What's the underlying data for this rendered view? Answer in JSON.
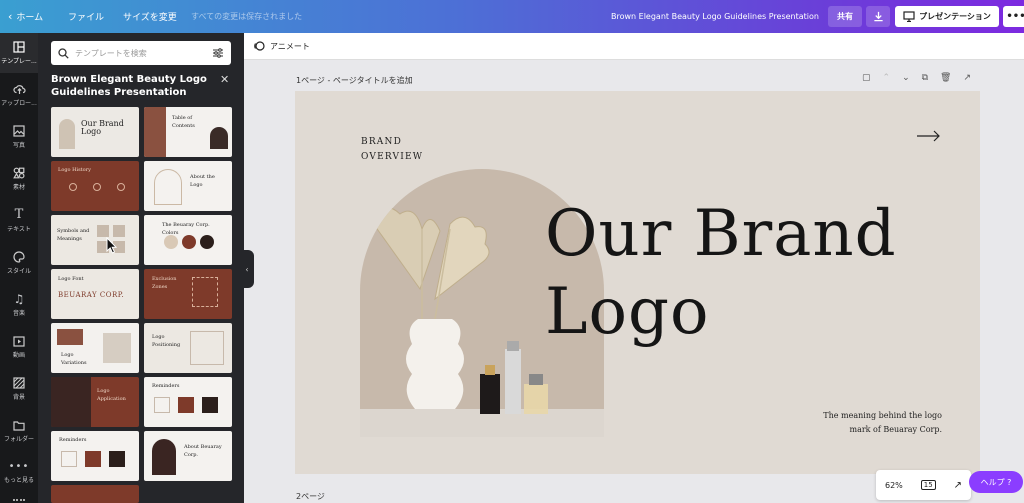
{
  "topbar": {
    "home_label": "ホーム",
    "file_label": "ファイル",
    "resize_label": "サイズを変更",
    "saved_status": "すべての変更は保存されました",
    "doc_title": "Brown Elegant Beauty Logo Guidelines Presentation",
    "share_label": "共有",
    "present_label": "プレゼンテーション",
    "more_label": "•••"
  },
  "rail": {
    "items": [
      {
        "label": "テンプレー...",
        "icon": "layout-icon"
      },
      {
        "label": "アップロー...",
        "icon": "upload-cloud-icon"
      },
      {
        "label": "写真",
        "icon": "photo-icon"
      },
      {
        "label": "素材",
        "icon": "elements-icon"
      },
      {
        "label": "テキスト",
        "icon": "text-icon"
      },
      {
        "label": "スタイル",
        "icon": "palette-icon"
      },
      {
        "label": "音楽",
        "icon": "music-icon"
      },
      {
        "label": "動画",
        "icon": "video-icon"
      },
      {
        "label": "背景",
        "icon": "background-icon"
      },
      {
        "label": "フォルダー",
        "icon": "folder-icon"
      },
      {
        "label": "もっと見る",
        "icon": "more-dots-icon"
      }
    ]
  },
  "panel": {
    "search_placeholder": "テンプレートを検索",
    "title": "Brown Elegant Beauty Logo Guidelines Presentation",
    "thumbnails": [
      {
        "text": "Our Brand Logo"
      },
      {
        "text": "Table of Contents"
      },
      {
        "text": "Logo History"
      },
      {
        "text": "About the Logo"
      },
      {
        "text": "Symbols and Meanings"
      },
      {
        "text": "The Beuaray Corp. Colors"
      },
      {
        "text": "Logo Font"
      },
      {
        "text": "BEUARAY CORP."
      },
      {
        "text": "Exclusion Zones"
      },
      {
        "text": "Logo Variations"
      },
      {
        "text": "Logo Positioning"
      },
      {
        "text": "Logo Application"
      },
      {
        "text": "Reminders"
      },
      {
        "text": "Reminders"
      },
      {
        "text": "About Beuaray Corp."
      }
    ]
  },
  "editor": {
    "animate_label": "アニメート",
    "page1_label": "1ページ - ページタイトルを追加",
    "page2_label": "2ページ",
    "zoom_value": "62%",
    "page_count": "15",
    "help_label": "ヘルプ ?"
  },
  "slide": {
    "brand_line1": "BRAND",
    "brand_line2": "OVERVIEW",
    "title_line1": "Our Brand",
    "title_line2": "Logo",
    "meaning_line1": "The meaning behind the logo",
    "meaning_line2": "mark of Beuaray Corp."
  },
  "colors": {
    "accent_purple": "#8b3dff",
    "slide_bg": "#e0dad3",
    "arch": "#c7b9ab",
    "brown": "#7e3a2a"
  }
}
